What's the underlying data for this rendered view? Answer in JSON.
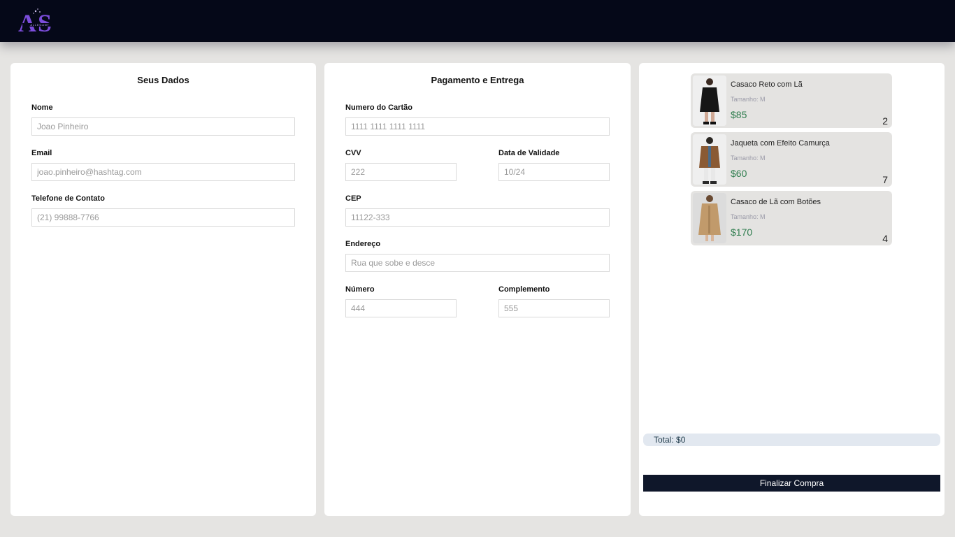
{
  "header": {
    "logo_text": "AS",
    "logo_sub": "ALLEGANT"
  },
  "dados": {
    "title": "Seus Dados",
    "nome": {
      "label": "Nome",
      "placeholder": "Joao Pinheiro"
    },
    "email": {
      "label": "Email",
      "placeholder": "joao.pinheiro@hashtag.com"
    },
    "telefone": {
      "label": "Telefone de Contato",
      "placeholder": "(21) 99888-7766"
    }
  },
  "pagamento": {
    "title": "Pagamento e Entrega",
    "cartao": {
      "label": "Numero do Cartão",
      "placeholder": "1111 1111 1111 1111"
    },
    "cvv": {
      "label": "CVV",
      "placeholder": "222"
    },
    "validade": {
      "label": "Data de Validade",
      "placeholder": "10/24"
    },
    "cep": {
      "label": "CEP",
      "placeholder": "11122-333"
    },
    "endereco": {
      "label": "Endereço",
      "placeholder": "Rua que sobe e desce"
    },
    "numero": {
      "label": "Número",
      "placeholder": "444"
    },
    "complemento": {
      "label": "Complemento",
      "placeholder": "555"
    }
  },
  "cart": {
    "items": [
      {
        "name": "Casaco Reto com Lã",
        "size": "Tamanho: M",
        "price": "$85",
        "qty": "2"
      },
      {
        "name": "Jaqueta com Efeito Camurça",
        "size": "Tamanho: M",
        "price": "$60",
        "qty": "7"
      },
      {
        "name": "Casaco de Lã com Botões",
        "size": "Tamanho: M",
        "price": "$170",
        "qty": "4"
      }
    ],
    "total": "Total: $0",
    "checkout_label": "Finalizar Compra"
  },
  "colors": {
    "topbar": "#050818",
    "logo": "#7c4ddb",
    "price": "#2f7d4e",
    "checkout": "#0f172a"
  }
}
